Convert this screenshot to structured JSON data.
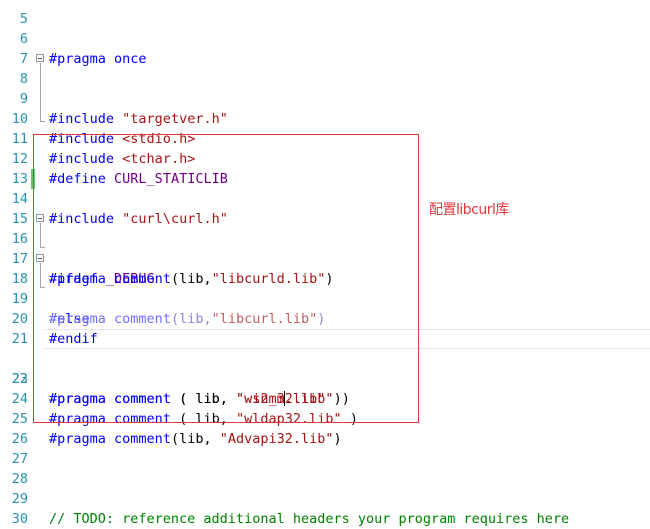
{
  "editor": {
    "language": "C++",
    "lines": [
      {
        "num": "5",
        "text": ""
      },
      {
        "num": "6",
        "text": "#pragma once"
      },
      {
        "num": "7",
        "text": ""
      },
      {
        "num": "8",
        "text": "#include \"targetver.h\""
      },
      {
        "num": "9",
        "text": ""
      },
      {
        "num": "10",
        "text": "#include <stdio.h>"
      },
      {
        "num": "11",
        "text": "#include <tchar.h>"
      },
      {
        "num": "12",
        "text": "#define CURL_STATICLIB"
      },
      {
        "num": "13",
        "text": ""
      },
      {
        "num": "14",
        "text": "#include \"curl\\curl.h\""
      },
      {
        "num": "15",
        "text": ""
      },
      {
        "num": "16",
        "text": "#ifdef _DEBUG"
      },
      {
        "num": "17",
        "text": "#pragma comment(lib,\"libcurld.lib\")"
      },
      {
        "num": "18",
        "text": "#else"
      },
      {
        "num": "19",
        "text": "#pragma comment(lib,\"libcurl.lib\")"
      },
      {
        "num": "20",
        "text": "#endif"
      },
      {
        "num": "21",
        "text": ""
      },
      {
        "num": "22",
        "text": "#pragma comment ( lib, \"ws2_32.lib\" )"
      },
      {
        "num": "23",
        "text": "#pragma comment ( lib, \"winmm.lib\" )"
      },
      {
        "num": "24",
        "text": "#pragma comment ( lib, \"wldap32.lib\" )"
      },
      {
        "num": "25",
        "text": "#pragma comment(lib, \"Advapi32.lib\")"
      },
      {
        "num": "26",
        "text": ""
      },
      {
        "num": "27",
        "text": ""
      },
      {
        "num": "28",
        "text": ""
      },
      {
        "num": "29",
        "text": "// TODO: reference additional headers your program requires here"
      },
      {
        "num": "30",
        "text": ""
      }
    ],
    "tokens": {
      "l6": [
        "#pragma",
        "once"
      ],
      "l8": [
        "#include",
        "\"targetver.h\""
      ],
      "l10": [
        "#include",
        "<stdio.h>"
      ],
      "l11": [
        "#include",
        "<tchar.h>"
      ],
      "l12": [
        "#define",
        "CURL_STATICLIB"
      ],
      "l14": [
        "#include",
        "\"curl\\curl.h\""
      ],
      "l16": [
        "#ifdef",
        "_DEBUG"
      ],
      "l17": [
        "#pragma",
        "comment",
        "(lib,",
        "\"libcurld.lib\"",
        ")"
      ],
      "l18": [
        "#else"
      ],
      "l19": [
        "#pragma",
        "comment",
        "(lib,",
        "\"libcurl.lib\"",
        ")"
      ],
      "l20": [
        "#endif"
      ],
      "l22": [
        "#pragma",
        "comment",
        "( lib,",
        "\"ws2_3",
        "2.lib\"",
        ")"
      ],
      "l23": [
        "#pragma",
        "comment",
        "( lib,",
        "\"winmm.lib\"",
        ")"
      ],
      "l24": [
        "#pragma",
        "comment",
        "( lib,",
        "\"wldap32.lib\"",
        ")"
      ],
      "l25": [
        "#pragma",
        "comment",
        "(lib,",
        "\"Advapi32.lib\"",
        ")"
      ],
      "l29": [
        "// TODO: reference additional headers your program requires here"
      ]
    },
    "current_line": "22",
    "changed_line": "14"
  },
  "annotation": {
    "label": "配置libcurl库",
    "color": "#e0393e"
  },
  "colors": {
    "line_number": "#2b91af",
    "preprocessor": "#0000ff",
    "string": "#a31515",
    "comment": "#008000",
    "change_marker": "#6cc36c"
  }
}
